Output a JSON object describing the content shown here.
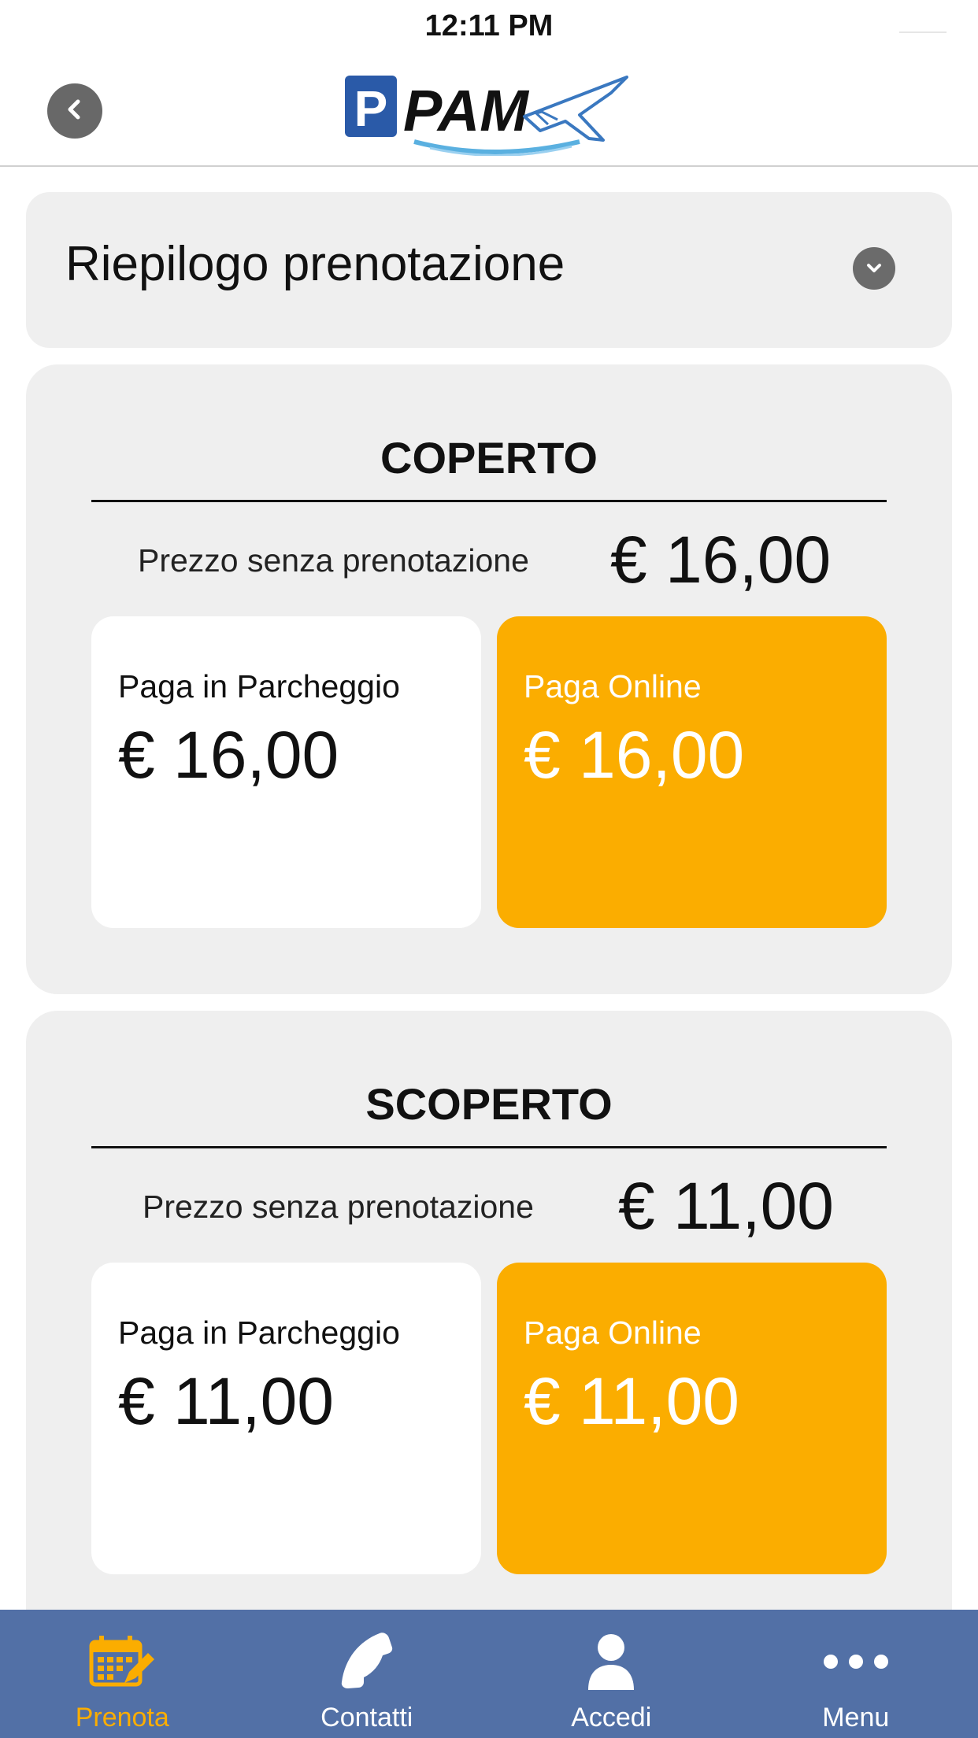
{
  "status_bar": {
    "time": "12:11 PM"
  },
  "header": {
    "back_icon": "chevron-left-icon",
    "logo_letter": "P",
    "logo_text": "PAM"
  },
  "summary": {
    "title": "Riepilogo prenotazione",
    "icon": "chevron-down-icon"
  },
  "sections": [
    {
      "title": "COPERTO",
      "no_booking_label": "Prezzo senza prenotazione",
      "no_booking_price": "€ 16,00",
      "pay_parking_label": "Paga in Parcheggio",
      "pay_parking_price": "€ 16,00",
      "pay_online_label": "Paga Online",
      "pay_online_price": "€ 16,00"
    },
    {
      "title": "SCOPERTO",
      "no_booking_label": "Prezzo senza prenotazione",
      "no_booking_price": "€ 11,00",
      "pay_parking_label": "Paga in Parcheggio",
      "pay_parking_price": "€ 11,00",
      "pay_online_label": "Paga Online",
      "pay_online_price": "€ 11,00"
    }
  ],
  "nav": [
    {
      "label": "Prenota",
      "icon": "calendar-edit-icon",
      "active": true
    },
    {
      "label": "Contatti",
      "icon": "phone-icon",
      "active": false
    },
    {
      "label": "Accedi",
      "icon": "user-icon",
      "active": false
    },
    {
      "label": "Menu",
      "icon": "more-dots-icon",
      "active": false
    }
  ],
  "colors": {
    "accent": "#fbad00",
    "nav_bg": "#5270a6",
    "card_bg": "#efefef",
    "logo_blue": "#2a5aa8"
  }
}
